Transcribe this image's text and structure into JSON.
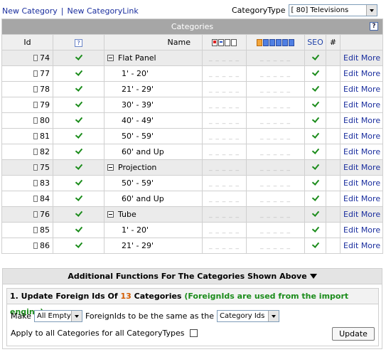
{
  "links": {
    "new_category": "New Category",
    "separator": "|",
    "new_category_link": "New CategoryLink"
  },
  "category_type": {
    "label": "CategoryType",
    "selected": "[ 80] Televisions"
  },
  "table": {
    "title": "Categories",
    "help_icon": "?",
    "headers": {
      "id": "Id",
      "active_help": "?",
      "name": "Name",
      "seo": "SEO",
      "hash": "#"
    },
    "rows": [
      {
        "id": "74",
        "name": "Flat Panel",
        "kind": "cat"
      },
      {
        "id": "77",
        "name": "1' - 20'",
        "kind": "sub"
      },
      {
        "id": "78",
        "name": "21' - 29'",
        "kind": "sub"
      },
      {
        "id": "79",
        "name": "30' - 39'",
        "kind": "sub"
      },
      {
        "id": "80",
        "name": "40' - 49'",
        "kind": "sub"
      },
      {
        "id": "81",
        "name": "50' - 59'",
        "kind": "sub"
      },
      {
        "id": "82",
        "name": "60' and Up",
        "kind": "sub"
      },
      {
        "id": "75",
        "name": "Projection",
        "kind": "cat"
      },
      {
        "id": "83",
        "name": "50' - 59'",
        "kind": "sub"
      },
      {
        "id": "84",
        "name": "60' and Up",
        "kind": "sub"
      },
      {
        "id": "76",
        "name": "Tube",
        "kind": "cat"
      },
      {
        "id": "85",
        "name": "1' - 20'",
        "kind": "sub"
      },
      {
        "id": "86",
        "name": "21' - 29'",
        "kind": "sub"
      }
    ],
    "edit_label": "Edit",
    "more_label": "More",
    "dashes": "_ _ _ _ _"
  },
  "functions": {
    "title": "Additional Functions For The Categories Shown Above",
    "update": {
      "prefix": "1. Update Foreign Ids Of",
      "count": "13",
      "suffix": "Categories",
      "note": "(ForeignIds are used from the import engine)",
      "make_label": "Make",
      "make_value": "All Empty",
      "middle_text": "ForeignIds to be the same as the",
      "source_value": "Category Ids",
      "apply_label": "Apply to all Categories for all CategoryTypes",
      "button": "Update"
    }
  }
}
